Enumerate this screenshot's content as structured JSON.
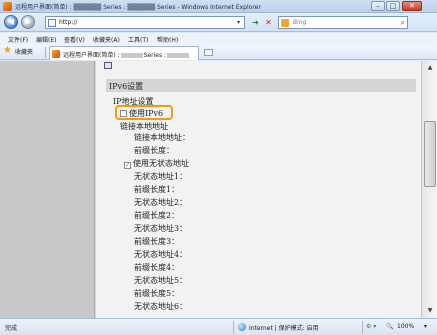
{
  "window": {
    "title": "远程用户界面(简单) : ▒▒▒▒▒▒ Series : ▒▒▒▒▒▒ Series - Windows Internet Explorer",
    "minimize": "–",
    "maximize": "□",
    "close": "✕"
  },
  "address": {
    "url": "http://",
    "dropdown": "▾",
    "refresh": "➜",
    "stop": "✕",
    "search_placeholder": "Bing",
    "search_go": "⌕"
  },
  "menu": [
    "文件(F)",
    "编辑(E)",
    "查看(V)",
    "收藏夹(A)",
    "工具(T)",
    "帮助(H)"
  ],
  "favorites": {
    "label": "收藏夹",
    "tab_title_prefix": "远程用户界面(简单) :",
    "tab_title_mid": "Series :"
  },
  "content": {
    "section_header": "IPv6设置",
    "group_title": "IP地址设置",
    "use_ipv6": "使用IPv6",
    "link_local_label": "链接本地地址",
    "link_local_address": "链接本地地址：",
    "link_local_prefix": "前缀长度：",
    "use_stateless": "使用无状态地址",
    "stateless_fields": [
      "无状态地址1：",
      "前缀长度1：",
      "无状态地址2：",
      "前缀长度2：",
      "无状态地址3：",
      "前缀长度3：",
      "无状态地址4：",
      "前缀长度4：",
      "无状态地址5：",
      "前缀长度5：",
      "无状态地址6："
    ]
  },
  "status": {
    "left": "完成",
    "zone": "Internet | 保护模式: 启用",
    "zoom": "100%"
  },
  "colors": {
    "highlight": "#f39c12",
    "content_bg": "#f2f2f2",
    "section_bg": "#d4d4d4"
  }
}
